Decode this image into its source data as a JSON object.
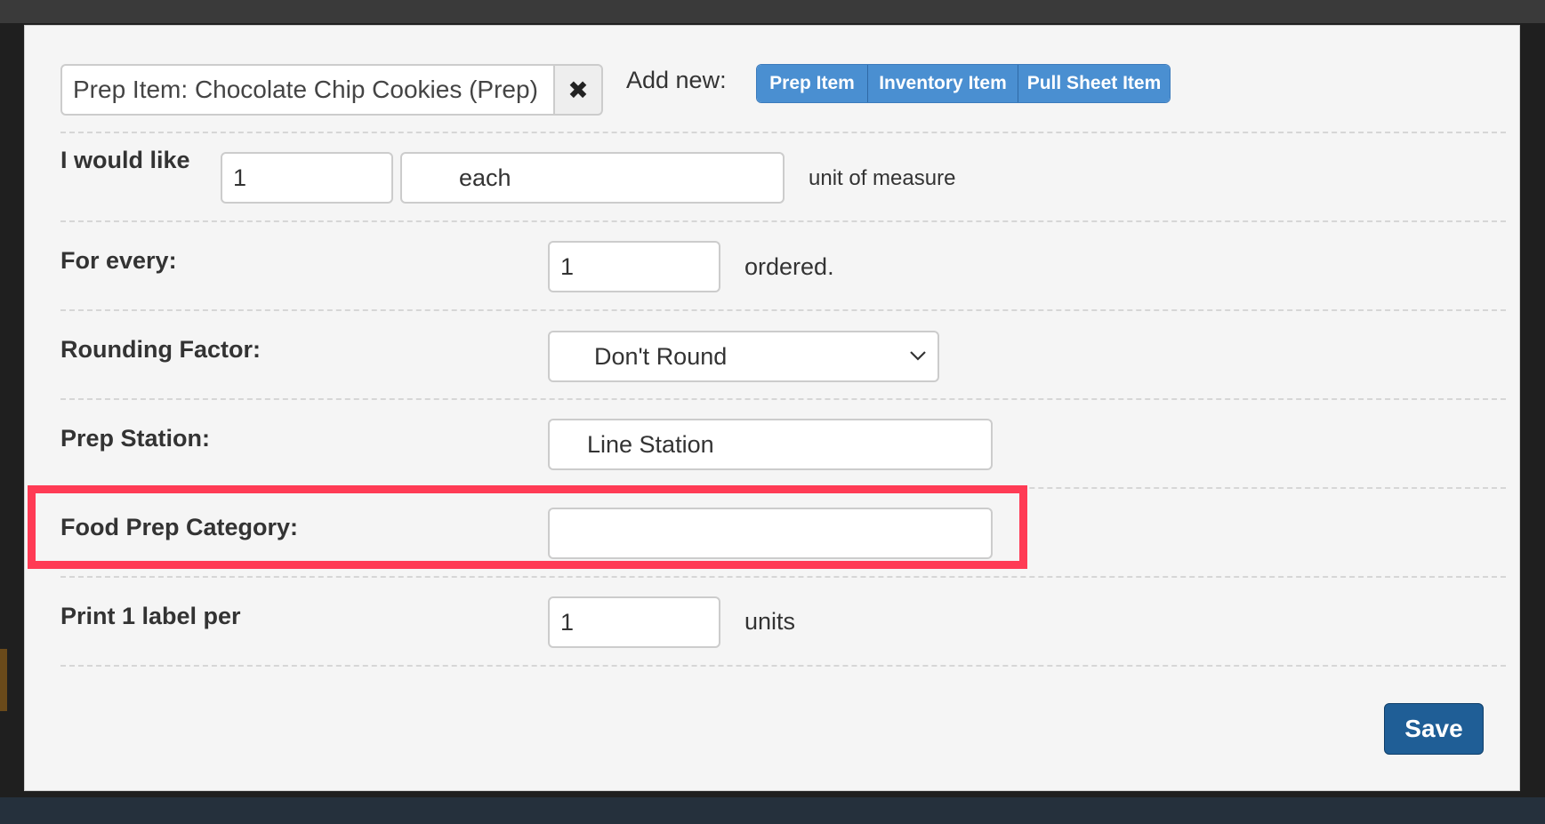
{
  "header": {
    "search_value": "Prep Item: Chocolate Chip Cookies (Prep)",
    "clear_glyph": "✖",
    "add_new_label": "Add new:",
    "add_buttons": [
      "Prep Item",
      "Inventory Item",
      "Pull Sheet Item"
    ]
  },
  "form": {
    "quantity": {
      "label": "I would like",
      "value": "1",
      "unit_value": "each",
      "suffix": "unit of measure"
    },
    "for_every": {
      "label": "For every:",
      "value": "1",
      "suffix": "ordered."
    },
    "rounding": {
      "label": "Rounding Factor:",
      "selected": "Don't Round"
    },
    "prep_station": {
      "label": "Prep Station:",
      "value": "Line Station"
    },
    "food_prep_category": {
      "label": "Food Prep Category:",
      "value": ""
    },
    "labels": {
      "label": "Print 1 label per",
      "value": "1",
      "suffix": "units"
    }
  },
  "footer": {
    "save_label": "Save"
  },
  "colors": {
    "primary_button": "#4a8fd1",
    "save_button": "#1f5e96",
    "highlight": "#ff3b55"
  }
}
